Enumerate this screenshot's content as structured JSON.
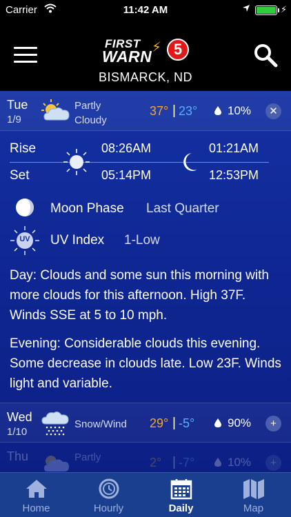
{
  "status_bar": {
    "carrier": "Carrier",
    "time": "11:42 AM"
  },
  "header": {
    "logo_line1": "FIRST",
    "logo_line2": "WARN",
    "logo_number": "5",
    "city": "BISMARCK, ND"
  },
  "colors": {
    "accent_hi": "#f0a830",
    "accent_lo": "#5aaeff",
    "header_bg": "#000000",
    "tabbar_bg": "#1a3f8f"
  },
  "selected_day": {
    "day": "Tue",
    "date": "1/9",
    "condition_line1": "Partly",
    "condition_line2": "Cloudy",
    "high": "37°",
    "separator": "|",
    "low": "23°",
    "precip": "10%",
    "toggle_icon": "close-icon"
  },
  "sun_moon": {
    "rise_label": "Rise",
    "set_label": "Set",
    "sunrise": "08:26AM",
    "sunset": "05:14PM",
    "moonrise": "01:21AM",
    "moonset": "12:53PM"
  },
  "moon_phase": {
    "label": "Moon Phase",
    "value": "Last Quarter"
  },
  "uv_index": {
    "label": "UV Index",
    "value": "1-Low",
    "icon_text": "UV"
  },
  "forecast_text": {
    "day": "Day: Clouds and some sun this morning with more clouds for this afternoon. High 37F. Winds SSE at 5 to 10 mph.",
    "evening": "Evening: Considerable clouds this evening. Some decrease in clouds late. Low 23F. Winds light and variable."
  },
  "next_days": [
    {
      "day": "Wed",
      "date": "1/10",
      "condition": "Snow/Wind",
      "high": "29°",
      "separator": "|",
      "low": "-5°",
      "precip": "90%"
    },
    {
      "day": "Thu",
      "date": "",
      "condition": "Partly",
      "high": "2°",
      "separator": "|",
      "low": "-7°",
      "precip": "10%"
    }
  ],
  "tabs": [
    {
      "label": "Home",
      "icon": "home-icon"
    },
    {
      "label": "Hourly",
      "icon": "clock-icon"
    },
    {
      "label": "Daily",
      "icon": "calendar-icon"
    },
    {
      "label": "Map",
      "icon": "map-icon"
    }
  ]
}
